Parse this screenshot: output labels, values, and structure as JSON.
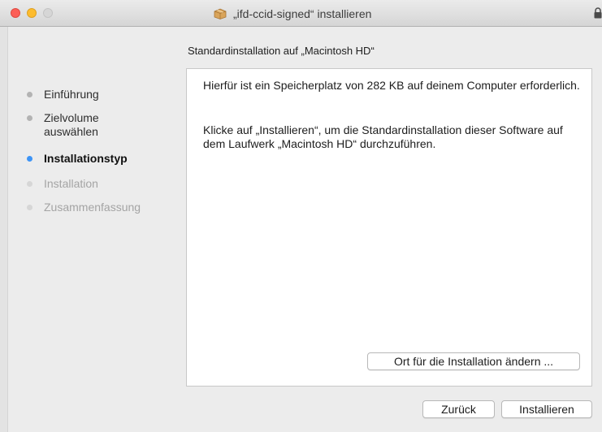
{
  "window": {
    "title": "„ifd-ccid-signed“ installieren"
  },
  "subtitle": "Standardinstallation auf „Macintosh HD“",
  "steps": [
    {
      "label": "Einführung",
      "state": "done"
    },
    {
      "label": "Zielvolume auswählen",
      "state": "done"
    },
    {
      "label": "Installationstyp",
      "state": "current"
    },
    {
      "label": "Installation",
      "state": "todo"
    },
    {
      "label": "Zusammenfassung",
      "state": "todo"
    }
  ],
  "content": {
    "paragraph1": "Hierfür ist ein Speicherplatz von 282 KB auf deinem Computer erforderlich.",
    "paragraph2": "Klicke auf „Installieren“, um die Standardinstallation dieser Software auf dem Laufwerk „Macintosh HD“ durchzuführen.",
    "change_location_label": "Ort für die Installation ändern ..."
  },
  "footer": {
    "back_label": "Zurück",
    "install_label": "Installieren"
  },
  "colors": {
    "current_step_dot": "#3d94f6",
    "close_button": "#fc5f57",
    "minimize_button": "#fdbc2e"
  },
  "icons": {
    "title": "package-icon",
    "lock": "lock-icon"
  }
}
